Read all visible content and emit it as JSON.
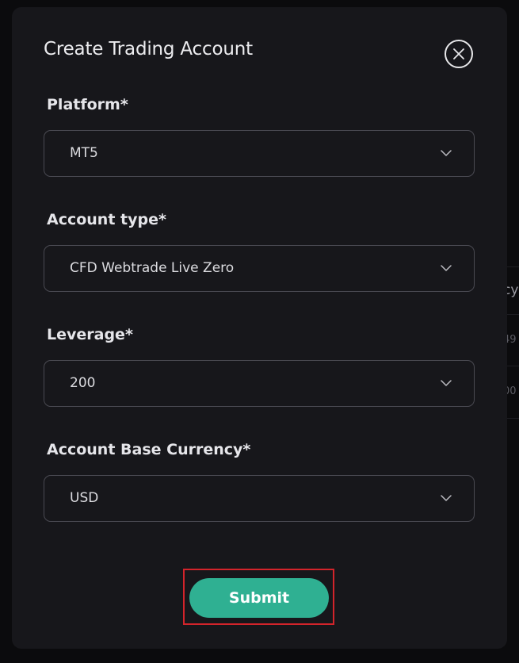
{
  "background": {
    "fragments": [
      "cy",
      "49",
      "00"
    ]
  },
  "modal": {
    "title": "Create Trading Account",
    "fields": [
      {
        "label": "Platform*",
        "value": "MT5"
      },
      {
        "label": "Account type*",
        "value": "CFD Webtrade Live Zero"
      },
      {
        "label": "Leverage*",
        "value": "200"
      },
      {
        "label": "Account Base Currency*",
        "value": "USD"
      }
    ],
    "submit_label": "Submit"
  },
  "icons": {
    "close": "close-icon",
    "dropdown": "chevron-down-icon"
  },
  "colors": {
    "modal_bg": "#17171b",
    "page_bg": "#0b0b0d",
    "accent": "#2fb092",
    "highlight": "#d3242b",
    "field_border": "#4a4a52"
  }
}
